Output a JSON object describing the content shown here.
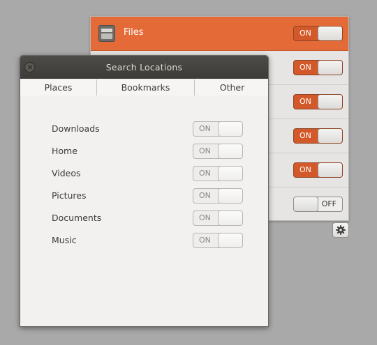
{
  "providers": {
    "rows": [
      {
        "label": "Files",
        "state": "ON",
        "selected": true
      },
      {
        "label": "",
        "state": "ON",
        "selected": false
      },
      {
        "label": "",
        "state": "ON",
        "selected": false
      },
      {
        "label": "",
        "state": "ON",
        "selected": false
      },
      {
        "label": "",
        "state": "ON",
        "selected": false
      },
      {
        "label": "",
        "state": "OFF",
        "selected": false
      }
    ],
    "settings_icon": "gear-icon"
  },
  "dialog": {
    "title": "Search Locations",
    "close_icon": "close-icon",
    "tabs": [
      {
        "label": "Places",
        "active": true
      },
      {
        "label": "Bookmarks",
        "active": false
      },
      {
        "label": "Other",
        "active": false
      }
    ],
    "locations": [
      {
        "label": "Downloads",
        "state": "ON"
      },
      {
        "label": "Home",
        "state": "ON"
      },
      {
        "label": "Videos",
        "state": "ON"
      },
      {
        "label": "Pictures",
        "state": "ON"
      },
      {
        "label": "Documents",
        "state": "ON"
      },
      {
        "label": "Music",
        "state": "ON"
      }
    ]
  },
  "colors": {
    "accent": "#e46b38",
    "switch_on": "#d4592a",
    "titlebar": "#3c3b37",
    "desktop": "#a9a9a9"
  }
}
